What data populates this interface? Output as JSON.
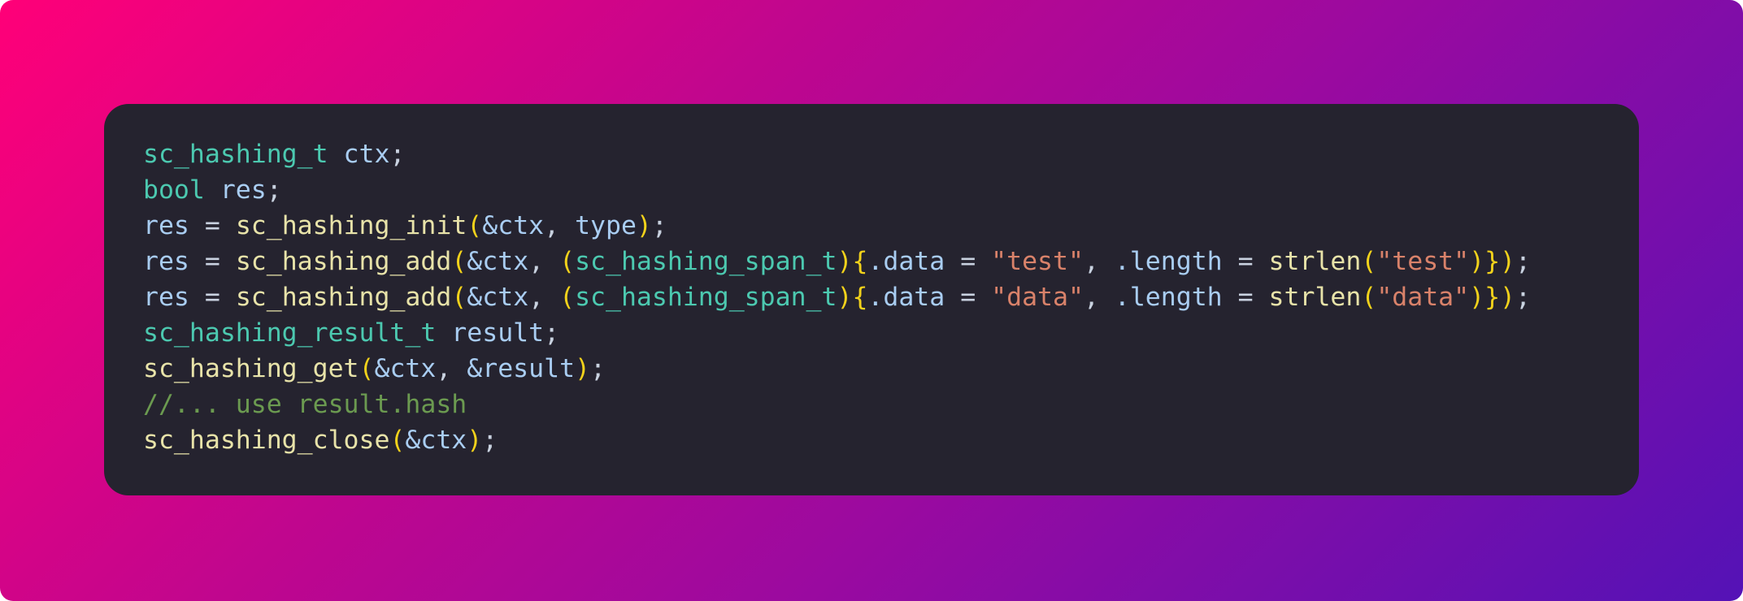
{
  "code_lines": [
    [
      {
        "t": "sc_hashing_t",
        "k": "type"
      },
      {
        "t": " ",
        "k": "var"
      },
      {
        "t": "ctx",
        "k": "var"
      },
      {
        "t": ";",
        "k": "punct"
      }
    ],
    [
      {
        "t": "bool",
        "k": "type"
      },
      {
        "t": " ",
        "k": "var"
      },
      {
        "t": "res",
        "k": "var"
      },
      {
        "t": ";",
        "k": "punct"
      }
    ],
    [
      {
        "t": "res",
        "k": "var"
      },
      {
        "t": " = ",
        "k": "op"
      },
      {
        "t": "sc_hashing_init",
        "k": "func"
      },
      {
        "t": "(",
        "k": "paren"
      },
      {
        "t": "&ctx",
        "k": "var"
      },
      {
        "t": ", ",
        "k": "punct"
      },
      {
        "t": "type",
        "k": "var"
      },
      {
        "t": ")",
        "k": "paren"
      },
      {
        "t": ";",
        "k": "punct"
      }
    ],
    [
      {
        "t": "res",
        "k": "var"
      },
      {
        "t": " = ",
        "k": "op"
      },
      {
        "t": "sc_hashing_add",
        "k": "func"
      },
      {
        "t": "(",
        "k": "paren"
      },
      {
        "t": "&ctx",
        "k": "var"
      },
      {
        "t": ", ",
        "k": "punct"
      },
      {
        "t": "(",
        "k": "paren"
      },
      {
        "t": "sc_hashing_span_t",
        "k": "type"
      },
      {
        "t": ")",
        "k": "paren"
      },
      {
        "t": "{",
        "k": "paren"
      },
      {
        "t": ".data",
        "k": "var"
      },
      {
        "t": " = ",
        "k": "op"
      },
      {
        "t": "\"test\"",
        "k": "string"
      },
      {
        "t": ", ",
        "k": "punct"
      },
      {
        "t": ".length",
        "k": "var"
      },
      {
        "t": " = ",
        "k": "op"
      },
      {
        "t": "strlen",
        "k": "func"
      },
      {
        "t": "(",
        "k": "paren"
      },
      {
        "t": "\"test\"",
        "k": "string"
      },
      {
        "t": ")",
        "k": "paren"
      },
      {
        "t": "}",
        "k": "paren"
      },
      {
        "t": ")",
        "k": "paren"
      },
      {
        "t": ";",
        "k": "punct"
      }
    ],
    [
      {
        "t": "res",
        "k": "var"
      },
      {
        "t": " = ",
        "k": "op"
      },
      {
        "t": "sc_hashing_add",
        "k": "func"
      },
      {
        "t": "(",
        "k": "paren"
      },
      {
        "t": "&ctx",
        "k": "var"
      },
      {
        "t": ", ",
        "k": "punct"
      },
      {
        "t": "(",
        "k": "paren"
      },
      {
        "t": "sc_hashing_span_t",
        "k": "type"
      },
      {
        "t": ")",
        "k": "paren"
      },
      {
        "t": "{",
        "k": "paren"
      },
      {
        "t": ".data",
        "k": "var"
      },
      {
        "t": " = ",
        "k": "op"
      },
      {
        "t": "\"data\"",
        "k": "string"
      },
      {
        "t": ", ",
        "k": "punct"
      },
      {
        "t": ".length",
        "k": "var"
      },
      {
        "t": " = ",
        "k": "op"
      },
      {
        "t": "strlen",
        "k": "func"
      },
      {
        "t": "(",
        "k": "paren"
      },
      {
        "t": "\"data\"",
        "k": "string"
      },
      {
        "t": ")",
        "k": "paren"
      },
      {
        "t": "}",
        "k": "paren"
      },
      {
        "t": ")",
        "k": "paren"
      },
      {
        "t": ";",
        "k": "punct"
      }
    ],
    [
      {
        "t": "sc_hashing_result_t",
        "k": "type"
      },
      {
        "t": " ",
        "k": "var"
      },
      {
        "t": "result",
        "k": "var"
      },
      {
        "t": ";",
        "k": "punct"
      }
    ],
    [
      {
        "t": "sc_hashing_get",
        "k": "func"
      },
      {
        "t": "(",
        "k": "paren"
      },
      {
        "t": "&ctx",
        "k": "var"
      },
      {
        "t": ", ",
        "k": "punct"
      },
      {
        "t": "&result",
        "k": "var"
      },
      {
        "t": ")",
        "k": "paren"
      },
      {
        "t": ";",
        "k": "punct"
      }
    ],
    [
      {
        "t": "//... use result.hash",
        "k": "comment"
      }
    ],
    [
      {
        "t": "sc_hashing_close",
        "k": "func"
      },
      {
        "t": "(",
        "k": "paren"
      },
      {
        "t": "&ctx",
        "k": "var"
      },
      {
        "t": ")",
        "k": "paren"
      },
      {
        "t": ";",
        "k": "punct"
      }
    ]
  ],
  "colors": {
    "background_start": "#ff0078",
    "background_end": "#5412b6",
    "card_background": "#25232f",
    "type": "#4cc9b0",
    "variable": "#a9cdf2",
    "function": "#e8e3a9",
    "paren": "#f2d21b",
    "string": "#d9826a",
    "comment": "#6b9a50"
  }
}
